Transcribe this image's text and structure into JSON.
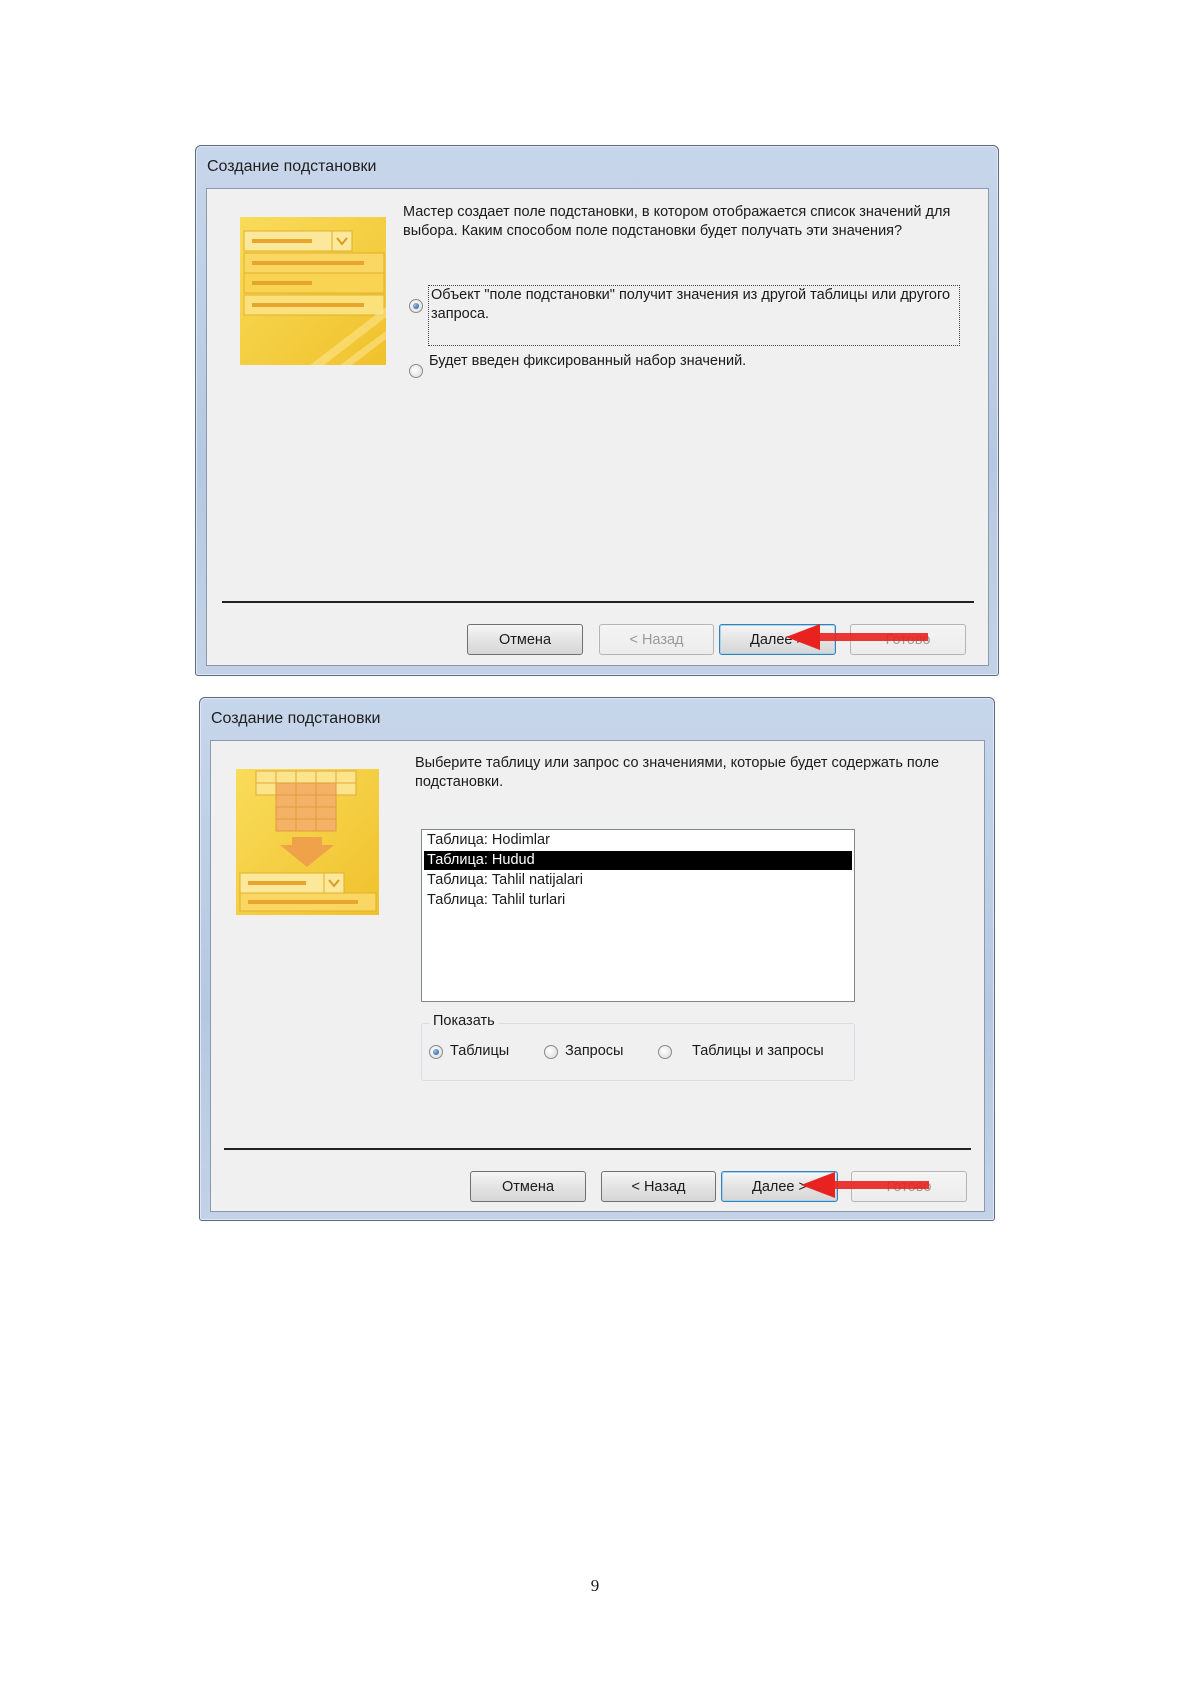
{
  "dialog1": {
    "title": "Создание подстановки",
    "description": "Мастер создает поле подстановки, в котором отображается список значений для выбора.  Каким способом поле подстановки будет получать эти значения?",
    "options": [
      {
        "label": "Объект \"поле подстановки\" получит значения из другой таблицы или другого запроса.",
        "checked": true
      },
      {
        "label": "Будет введен фиксированный набор значений.",
        "checked": false
      }
    ],
    "buttons": {
      "cancel": "Отмена",
      "back": "< Назад",
      "next": "Далее >",
      "finish": "Готово"
    }
  },
  "dialog2": {
    "title": "Создание подстановки",
    "description": "Выберите таблицу или запрос со значениями, которые будет содержать поле подстановки.",
    "list_items": [
      {
        "label": "Таблица: Hodimlar",
        "selected": false
      },
      {
        "label": "Таблица: Hudud",
        "selected": true
      },
      {
        "label": "Таблица: Tahlil natijalari",
        "selected": false
      },
      {
        "label": "Таблица: Tahlil turlari",
        "selected": false
      }
    ],
    "show_group": {
      "legend": "Показать",
      "options": [
        {
          "label": "Таблицы",
          "checked": true
        },
        {
          "label": "Запросы",
          "checked": false
        },
        {
          "label": "Таблицы и запросы",
          "checked": false
        }
      ]
    },
    "buttons": {
      "cancel": "Отмена",
      "back": "< Назад",
      "next": "Далее >",
      "finish": "Готово"
    }
  },
  "page_number": "9",
  "colors": {
    "arrow": "#e8231f",
    "illustration": "#f5cf3a",
    "selection": "#000000"
  }
}
